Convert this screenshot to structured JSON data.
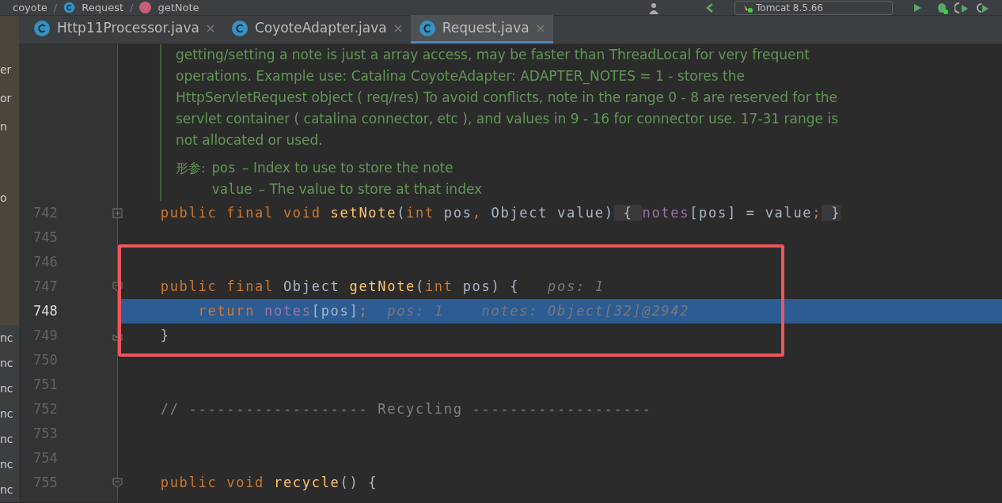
{
  "breadcrumbs": [
    {
      "label": "coyote"
    },
    {
      "separator": "/",
      "label": "Request"
    },
    {
      "separator": "/",
      "label": "getNote"
    }
  ],
  "run_config": {
    "label": "Tomcat 8.5.66"
  },
  "project_tree": {
    "items": [
      "er",
      "or",
      "n",
      "o",
      "nc",
      "nc",
      "nc",
      "nc",
      "nc",
      "nc",
      "nc"
    ]
  },
  "tabs": [
    {
      "label": "Http11Processor.java",
      "selected": false
    },
    {
      "label": "CoyoteAdapter.java",
      "selected": false
    },
    {
      "label": "Request.java",
      "selected": true
    }
  ],
  "doc": {
    "lines": [
      "getting/setting a note is just a array access, may be faster than ThreadLocal for very frequent",
      "operations. Example use: Catalina CoyoteAdapter: ADAPTER_NOTES = 1 - stores the",
      "HttpServletRequest object ( req/res) To avoid conflicts, note in the range 0 - 8 are reserved for the",
      "servlet container ( catalina connector, etc ), and values in 9 - 16 for connector use. 17-31 range is",
      "not allocated or used."
    ],
    "params_label": "形参:",
    "params": [
      {
        "name": "pos",
        "description": "– Index to use to store the note"
      },
      {
        "name": "value",
        "description": "– The value to store at that index"
      }
    ]
  },
  "code_lines": [
    {
      "number": "742",
      "kind": "collapsed",
      "current": false,
      "framed": false,
      "tokens": [
        {
          "kind": "kw",
          "text": "    public final void "
        },
        {
          "kind": "fn",
          "text": "setNote"
        },
        {
          "kind": "plain",
          "text": "("
        },
        {
          "kind": "kw",
          "text": "int "
        },
        {
          "kind": "plain",
          "text": "pos"
        },
        {
          "kind": "kw",
          "text": ", "
        },
        {
          "kind": "plain",
          "text": "Object value)"
        },
        {
          "kind": "folded",
          "text": " { "
        },
        {
          "kind": "field",
          "text": "notes"
        },
        {
          "kind": "plain",
          "text": "[pos] = value"
        },
        {
          "kind": "kw",
          "text": ";"
        },
        {
          "kind": "folded",
          "text": " }"
        }
      ]
    },
    {
      "number": "745",
      "kind": "plain",
      "current": false,
      "framed": false
    },
    {
      "number": "746",
      "kind": "plain",
      "current": false,
      "framed": true
    },
    {
      "number": "747",
      "kind": "fold-start",
      "current": false,
      "framed": true,
      "tokens": [
        {
          "kind": "kw",
          "text": "    public final "
        },
        {
          "kind": "plain",
          "text": "Object "
        },
        {
          "kind": "fn",
          "text": "getNote"
        },
        {
          "kind": "plain",
          "text": "("
        },
        {
          "kind": "kw",
          "text": "int "
        },
        {
          "kind": "plain",
          "text": "pos) {   "
        },
        {
          "kind": "hint",
          "text": "pos: 1"
        }
      ]
    },
    {
      "number": "748",
      "kind": "plain",
      "current": true,
      "framed": true,
      "tokens": [
        {
          "kind": "kw",
          "text": "        return "
        },
        {
          "kind": "field",
          "text": "notes"
        },
        {
          "kind": "plain",
          "text": "[pos]"
        },
        {
          "kind": "kw",
          "text": ";  "
        },
        {
          "kind": "hint",
          "text": "pos: 1    notes: Object[32]@2942"
        }
      ]
    },
    {
      "number": "749",
      "kind": "fold-end",
      "current": false,
      "framed": true,
      "tokens": [
        {
          "kind": "plain",
          "text": "    }"
        }
      ]
    },
    {
      "number": "750",
      "kind": "plain",
      "current": false,
      "framed": false
    },
    {
      "number": "751",
      "kind": "plain",
      "current": false,
      "framed": false
    },
    {
      "number": "752",
      "kind": "plain",
      "current": false,
      "framed": false,
      "tokens": [
        {
          "kind": "comment",
          "text": "    // ------------------- Recycling -------------------"
        }
      ]
    },
    {
      "number": "753",
      "kind": "plain",
      "current": false,
      "framed": false
    },
    {
      "number": "754",
      "kind": "plain",
      "current": false,
      "framed": false
    },
    {
      "number": "755",
      "kind": "fold-start",
      "current": false,
      "framed": false,
      "tokens": [
        {
          "kind": "kw",
          "text": "    public void "
        },
        {
          "kind": "fn",
          "text": "recycle"
        },
        {
          "kind": "plain",
          "text": "() {"
        }
      ]
    }
  ]
}
